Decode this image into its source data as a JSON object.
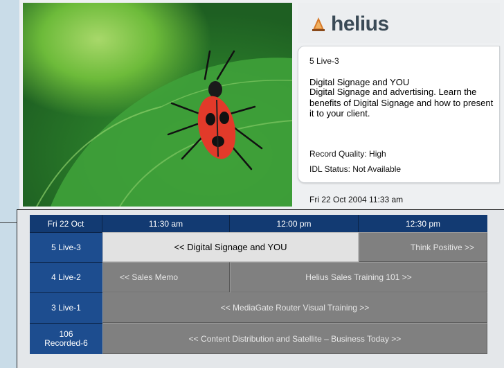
{
  "brand": {
    "name": "helius",
    "icon": "helius-logo-icon"
  },
  "info": {
    "channel": "5 Live-3",
    "program_title": "Digital Signage and YOU",
    "description": "Digital Signage and advertising. Learn the benefits of Digital Signage and how to present it to your client.",
    "record_quality": "Record Quality: High",
    "idl_status": "IDL Status:  Not Available",
    "datetime": "Fri  22 Oct 2004  11:33 am"
  },
  "guide": {
    "date": "Fri 22 Oct",
    "times": [
      "11:30 am",
      "12:00 pm",
      "12:30 pm"
    ],
    "channels": [
      {
        "name": "5 Live-3",
        "programs": [
          {
            "title": "<< Digital Signage and YOU"
          },
          {
            "title": "Think Positive >>"
          }
        ]
      },
      {
        "name": "4 Live-2",
        "programs": [
          {
            "title": "<< Sales Memo"
          },
          {
            "title": "Helius Sales Training 101 >>"
          }
        ]
      },
      {
        "name": "3 Live-1",
        "programs": [
          {
            "title": "<< MediaGate Router Visual Training >>"
          }
        ]
      },
      {
        "name_line1": "106",
        "name_line2": "Recorded-6",
        "programs": [
          {
            "title": "<< Content Distribution and Satellite –  Business Today >>"
          }
        ]
      }
    ]
  }
}
